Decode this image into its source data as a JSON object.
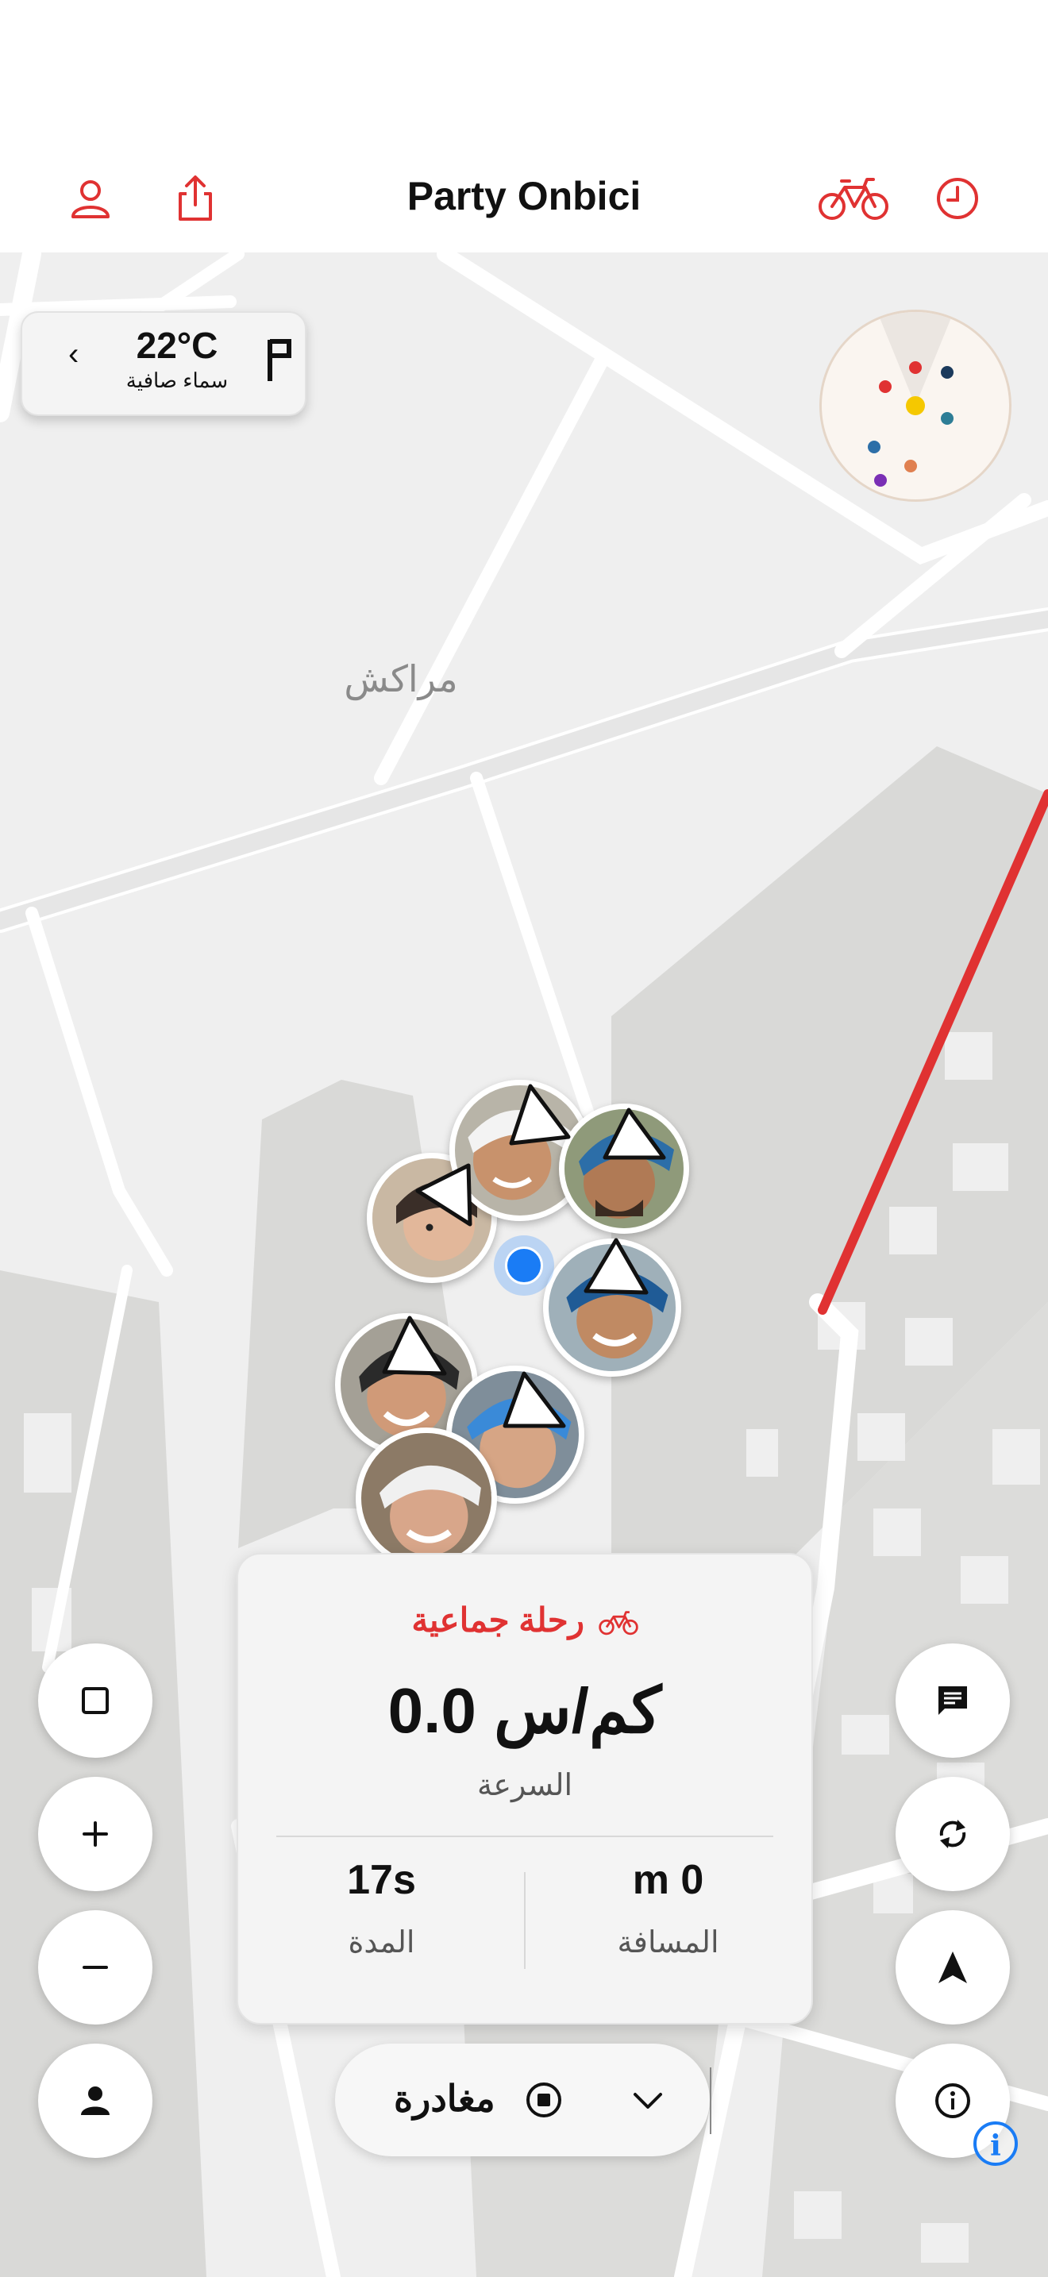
{
  "header": {
    "title": "Party Onbici",
    "icons": [
      "user-icon",
      "share-icon",
      "bike-icon",
      "history-clock-icon"
    ],
    "accent": "#e03232"
  },
  "weather": {
    "temperature": "22°C",
    "condition": "سماء صافية"
  },
  "map": {
    "city_label": "مراكش",
    "route_color": "#e03232"
  },
  "radar": {
    "dot_colors": [
      "#e03232",
      "#1b3a5c",
      "#e03232",
      "#f5c800",
      "#2d7d96",
      "#2d6fa8",
      "#e08050",
      "#7a2fb5"
    ]
  },
  "group_members": {
    "count": 7
  },
  "controls": {
    "left": [
      "square-icon",
      "zoom-in-icon",
      "zoom-out-icon",
      "person-icon"
    ],
    "right": [
      "chat-icon",
      "refresh-icon",
      "navigation-arrow-icon",
      "info-icon"
    ]
  },
  "ride_card": {
    "title": "رحلة جماعية",
    "speed": "0.0 كم/س",
    "speed_label": "السرعة",
    "duration_value": "17s",
    "duration_label": "المدة",
    "distance_value": "m 0",
    "distance_label": "المسافة"
  },
  "leave_button": {
    "label": "مغادرة"
  },
  "colors": {
    "accent": "#e03232",
    "location_blue": "#1a7cf5"
  }
}
